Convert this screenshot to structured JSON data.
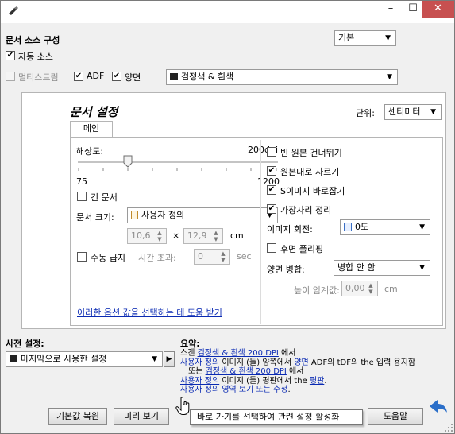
{
  "title_bar": {
    "minimize": "–",
    "maximize": "☐",
    "close": "✕"
  },
  "header": {
    "title": "문서 소스 구성",
    "preset": "기본",
    "auto_source": "자동 소스",
    "multistream": "멀티스트림",
    "adf": "ADF",
    "duplex": "양면",
    "color_mode": "검정색 & 흰색"
  },
  "panel": {
    "title": "문서 설정",
    "unit_label": "단위:",
    "unit_value": "센티미터",
    "tab_main": "메인",
    "resolution_label": "해상도:",
    "resolution_value": "200dpi",
    "resolution_fraction": 0.25,
    "slider_min": "75",
    "slider_max": "1200",
    "long_document": "긴 문서",
    "doc_size_label": "문서 크기:",
    "doc_size_value": "사용자 정의",
    "width": "10,6",
    "height": "12,9",
    "times": "×",
    "size_unit": "cm",
    "manual_feed": "수동 급지",
    "timeout_label": "시간 초과:",
    "timeout_value": "0",
    "timeout_unit": "sec",
    "help_link": "이러한 옵션 값을 선택하는 데 도움 받기",
    "skip_blank": "빈 원본 건너뛰기",
    "crop_to_original": "원본대로 자르기",
    "deskew": "S이미지 바로잡기",
    "edge_cleanup": "가장자리 정리",
    "rotate_label": "이미지 회전:",
    "rotate_value": "0도",
    "back_flip": "후면 플리핑",
    "merge_label": "양면 병합:",
    "merge_value": "병합 안 함",
    "height_threshold_label": "높이 임계값:",
    "height_threshold_value": "0,00",
    "height_threshold_unit": "cm"
  },
  "bottom": {
    "presets_label": "사전 설정:",
    "preset_value": "마지막으로 사용한 설정",
    "summary_label": "요약:",
    "summary_l1_a": "스캔 ",
    "summary_l1_link": "검정색 & 흰색 200 DPI",
    "summary_l1_b": " 에서",
    "summary_l2_link1": "사용자 정의",
    "summary_l2_a": " 이미지 (들) 양쪽에서 ",
    "summary_l2_link2": "양면",
    "summary_l2_b": " ADF의 tDF의 the 입력 용지함",
    "summary_l3_a": "또는 ",
    "summary_l3_link": "검정색 & 흰색 200 DPI",
    "summary_l3_b": " 에서",
    "summary_l4_link1": "사용자 정의",
    "summary_l4_a": " 이미지 (들) 평판에서 the ",
    "summary_l4_link2": "평판",
    "summary_l4_b": ".",
    "summary_l5_link": "사용자 정의 영역 보기 또는 수정",
    "summary_l5_b": ".",
    "restore_button": "기본값 복원",
    "preview_button": "미리 보기",
    "help_button": "도움말",
    "tooltip": "바로 가기를 선택하여 관련 설정 활성화"
  },
  "colors": {
    "link": "#0a2ab3",
    "close_button": "#c75050",
    "undo_arrow": "#2b6fc9"
  }
}
